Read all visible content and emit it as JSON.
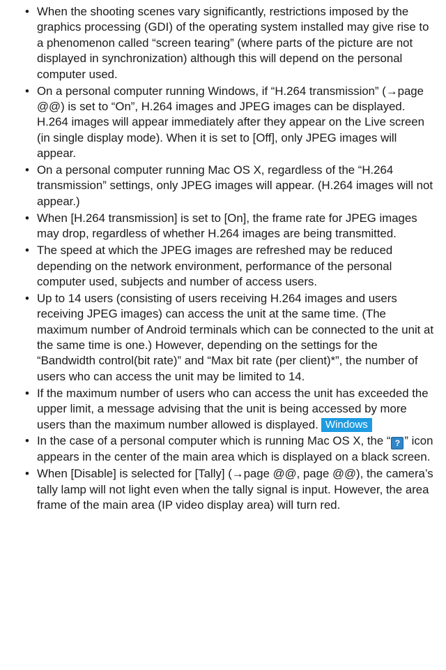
{
  "bullet_symbol": "•",
  "items": [
    {
      "text": "When the shooting scenes vary significantly, restrictions imposed by the graphics processing (GDI) of the operating system installed may give rise to a phenomenon called “screen tearing” (where parts of the picture are not displayed in synchronization) although this will depend on the personal computer used."
    },
    {
      "text": "On a personal computer running Windows, if “H.264 transmission” (→page @@) is set to “On”, H.264 images and JPEG images can be displayed. H.264 images will appear immediately after they appear on the Live screen (in single display mode). When it is set to [Off], only JPEG images will appear."
    },
    {
      "text": "On a personal computer running Mac OS X, regardless of the “H.264 transmission” settings, only JPEG images will appear. (H.264 images will not appear.)"
    },
    {
      "text": "When [H.264 transmission] is set to [On], the frame rate for JPEG images may drop, regardless of whether H.264 images are being transmitted."
    },
    {
      "text": "The speed at which the JPEG images are refreshed may be reduced depending on the network environment, performance of the personal computer used, subjects and number of access users."
    },
    {
      "text": "Up to 14 users (consisting of users receiving H.264 images and users receiving JPEG images) can access the unit at the same time. (The maximum number of Android terminals which can be connected to the unit at the same time is one.) However, depending on the settings for the “Bandwidth control(bit rate)” and “Max bit rate (per client)*”, the number of users who can access the unit may be limited to 14."
    },
    {
      "text": "If the maximum number of users who can access the unit has exceeded the upper limit, a message advising that the unit is being accessed by more users than the maximum number allowed is displayed.",
      "badge": "Windows",
      "badge_color": "#1e9be1"
    },
    {
      "text_before": "In the case of a personal computer which is running Mac OS X, the “",
      "icon_glyph": "?",
      "icon": "help-icon",
      "text_after": "” icon appears in the center of the main area which is displayed on a black screen."
    },
    {
      "text": "When [Disable] is selected for [Tally] (→page @@, page @@), the camera’s tally lamp will not light even when the tally signal is input. However, the area frame of the main area (IP video display area) will turn red."
    }
  ]
}
